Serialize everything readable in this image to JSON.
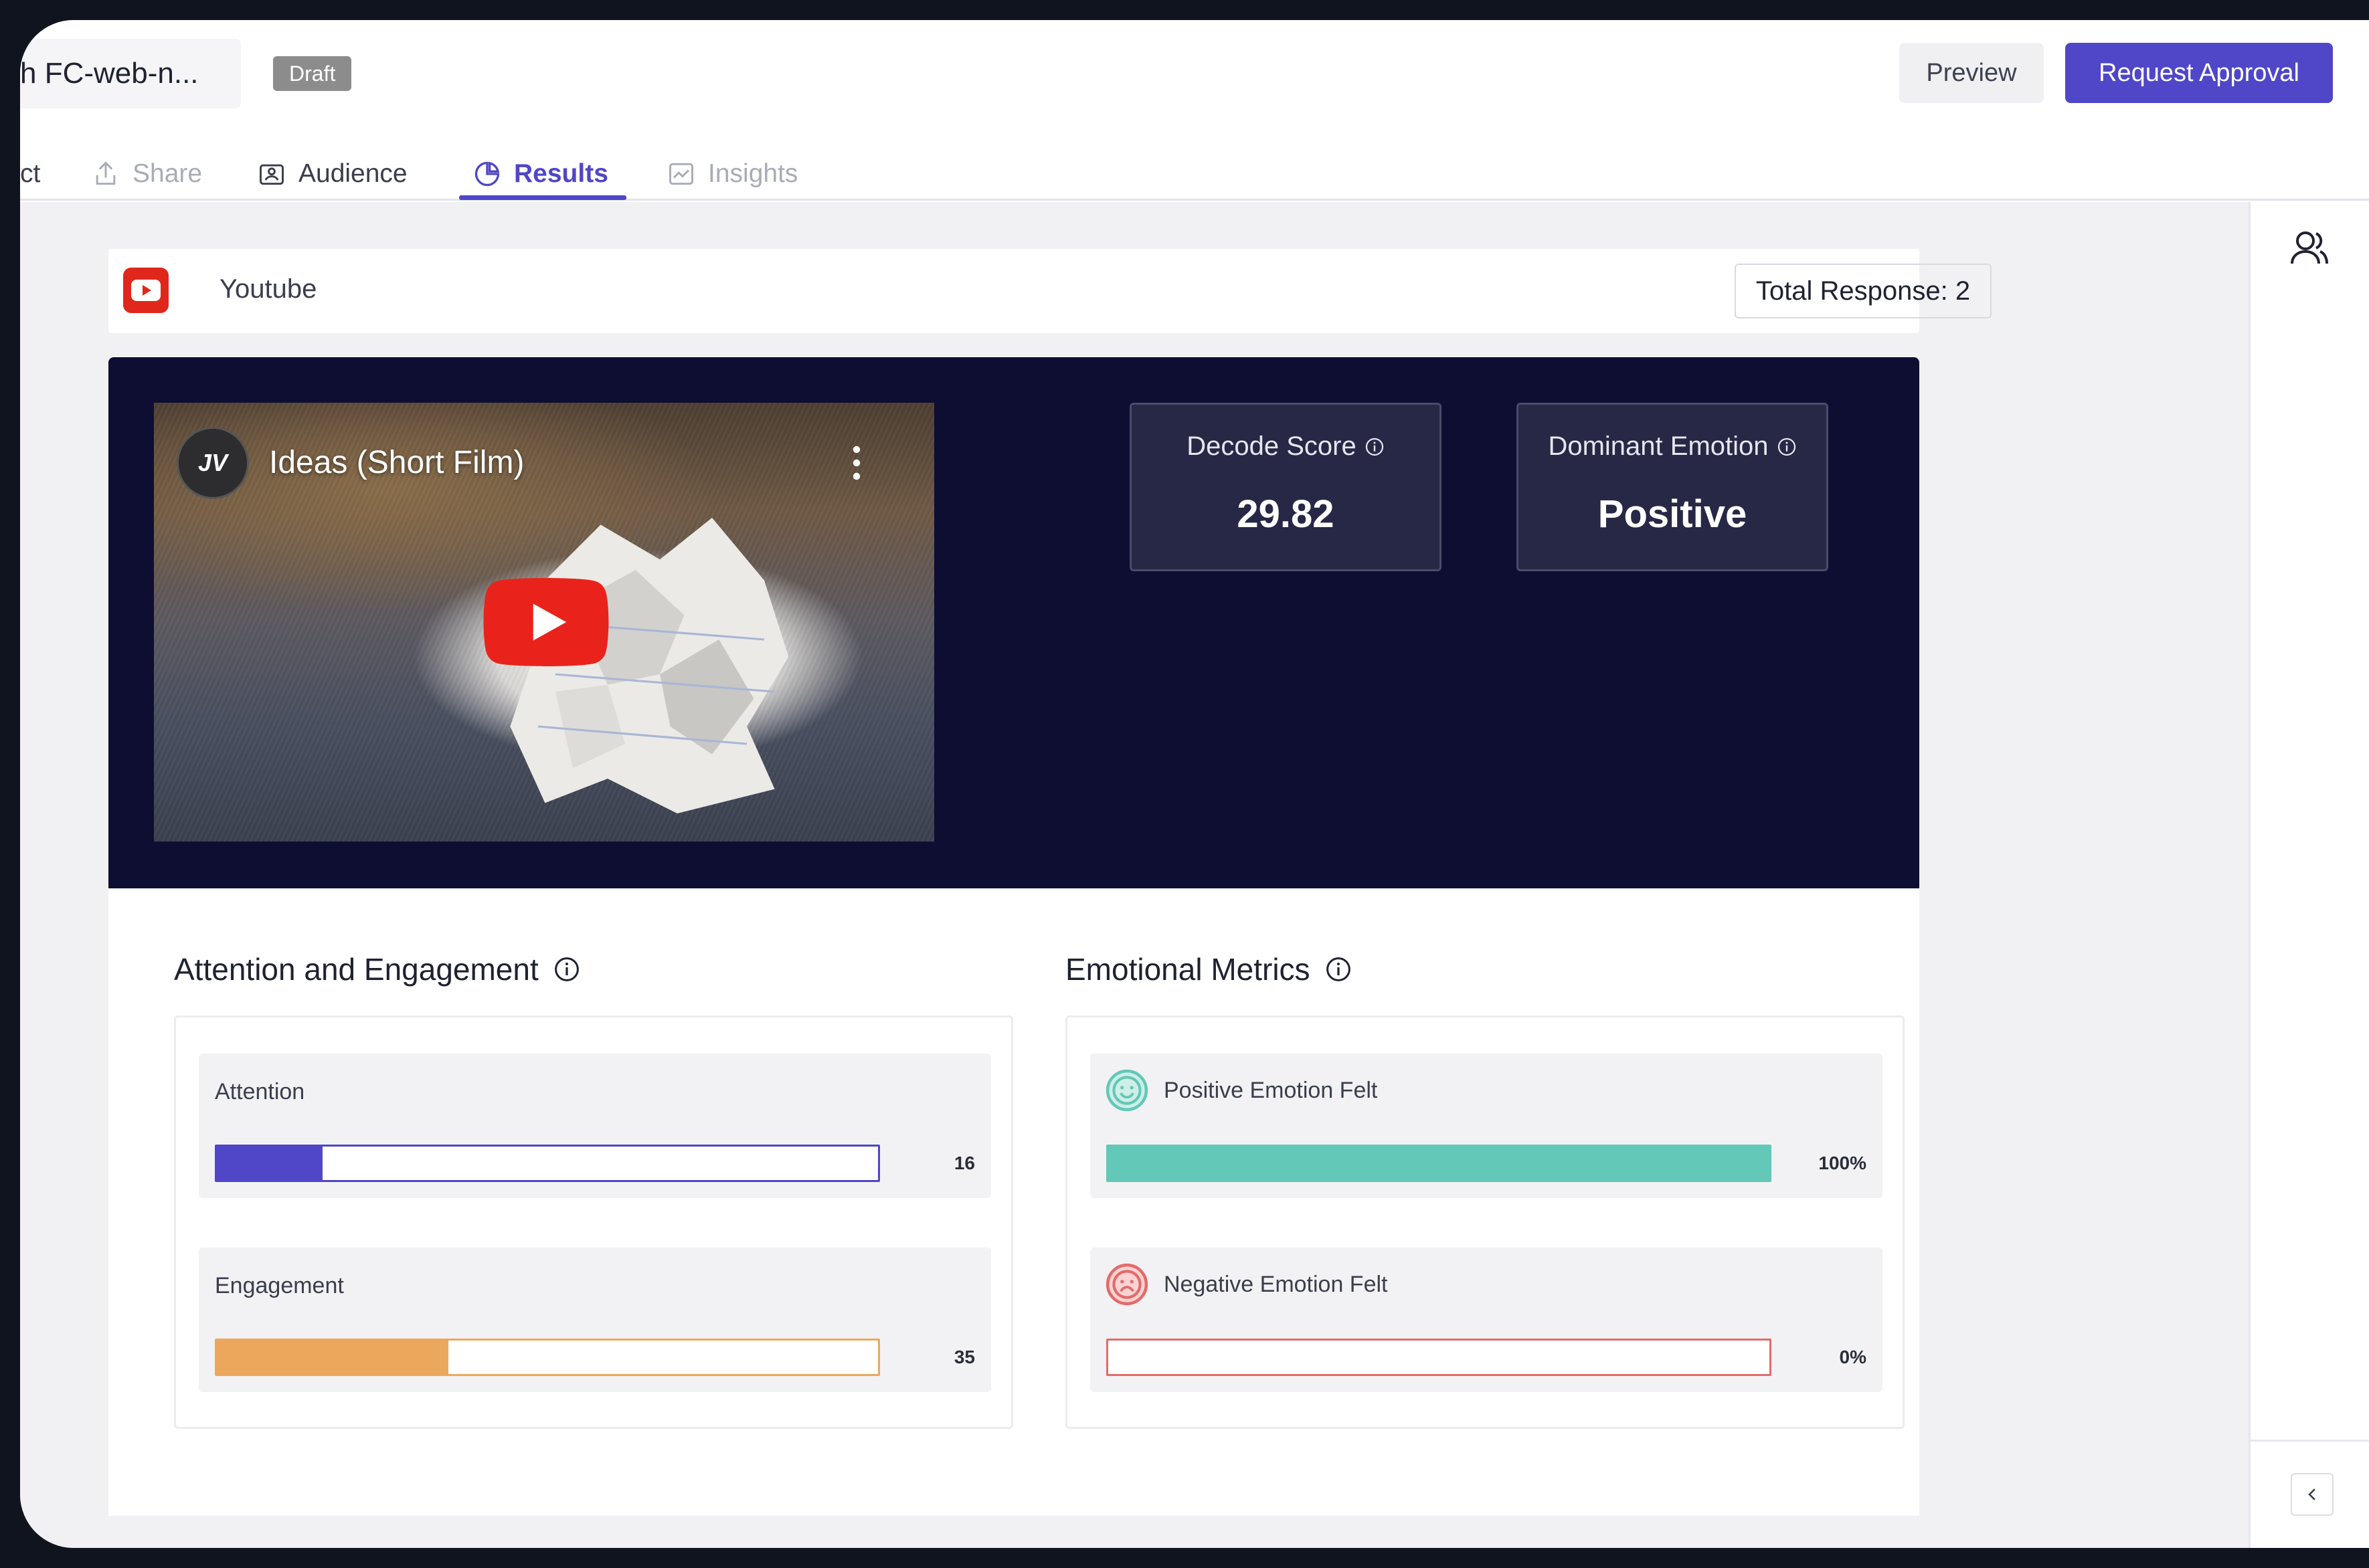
{
  "header": {
    "project_name": "h FC-web-n...",
    "status_badge": "Draft",
    "preview_label": "Preview",
    "request_label": "Request Approval"
  },
  "tabs": [
    {
      "label": "ct",
      "icon": "none",
      "state": "normal"
    },
    {
      "label": "Share",
      "icon": "share-icon",
      "state": "disabled"
    },
    {
      "label": "Audience",
      "icon": "audience-icon",
      "state": "normal"
    },
    {
      "label": "Results",
      "icon": "pie-chart-icon",
      "state": "active"
    },
    {
      "label": "Insights",
      "icon": "insights-icon",
      "state": "disabled"
    }
  ],
  "source": {
    "platform": "Youtube",
    "total_response": "Total Response: 2"
  },
  "video": {
    "title": "Ideas (Short Film)",
    "channel_initials": "JV"
  },
  "scores": {
    "decode_label": "Decode Score",
    "decode_value": "29.82",
    "emotion_label": "Dominant Emotion",
    "emotion_value": "Positive"
  },
  "attention_section": {
    "title": "Attention and Engagement",
    "metrics": [
      {
        "label": "Attention",
        "value_text": "16",
        "fraction": 0.16,
        "color": "#5046c8",
        "border": "#5046c8"
      },
      {
        "label": "Engagement",
        "value_text": "35",
        "fraction": 0.35,
        "color": "#eba85d",
        "border": "#eba85d"
      }
    ]
  },
  "emotion_section": {
    "title": "Emotional Metrics",
    "metrics": [
      {
        "label": "Positive Emotion Felt",
        "value_text": "100%",
        "fraction": 1.0,
        "color": "#63c8b7",
        "border": "#63c8b7"
      },
      {
        "label": "Negative Emotion Felt",
        "value_text": "0%",
        "fraction": 0.0,
        "color": "#e46a6a",
        "border": "#e46a6a"
      }
    ]
  },
  "colors": {
    "accent": "#4f46c8",
    "hero_bg": "#0d0e32",
    "card_bg": "#272846"
  }
}
